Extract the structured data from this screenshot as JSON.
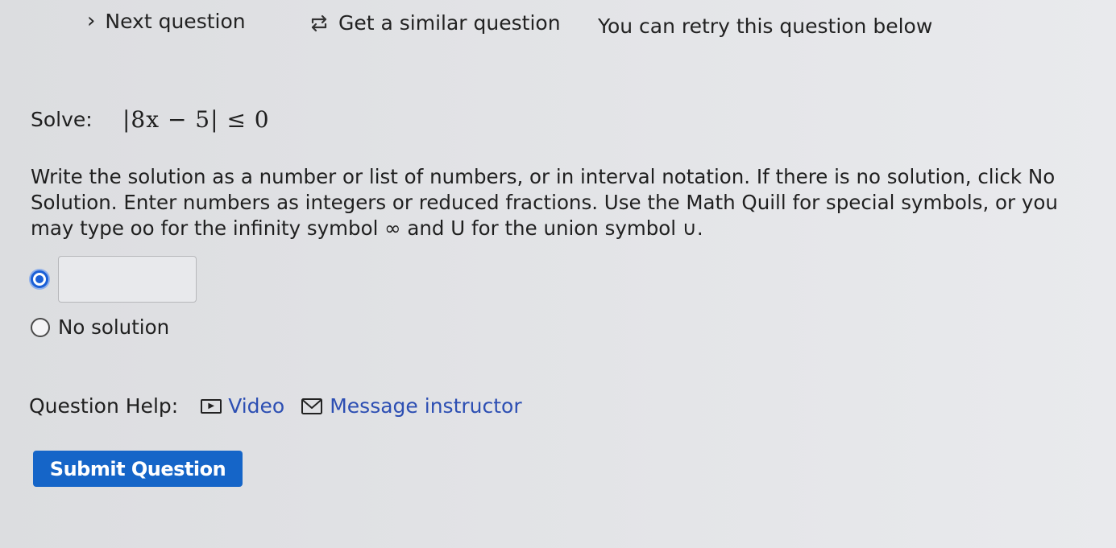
{
  "topbar": {
    "next_label": "Next question",
    "similar_label": "Get a similar question",
    "retry_text": "You can retry this question below"
  },
  "problem": {
    "solve_label": "Solve:",
    "expression": "|8x − 5| ≤ 0"
  },
  "instructions": {
    "line1": "Write the solution as a number or list of numbers, or in interval notation. If there is no solution, click No",
    "line2": "Solution. Enter numbers as integers or reduced fractions. Use the Math Quill for special symbols, or you",
    "line3": "may type oo for the infinity symbol ∞ and U for the union symbol ∪."
  },
  "answer": {
    "value": "",
    "selected_option": "answer"
  },
  "no_solution": {
    "label": "No solution"
  },
  "help": {
    "label": "Question Help:",
    "video_label": "Video",
    "message_label": "Message instructor"
  },
  "submit": {
    "label": "Submit Question"
  },
  "colors": {
    "accent": "#1565c8",
    "link": "#2d4fb3"
  },
  "icons": {
    "next": "chevron-right-icon",
    "similar": "refresh-arrows-icon",
    "video": "video-play-icon",
    "message": "envelope-icon"
  }
}
